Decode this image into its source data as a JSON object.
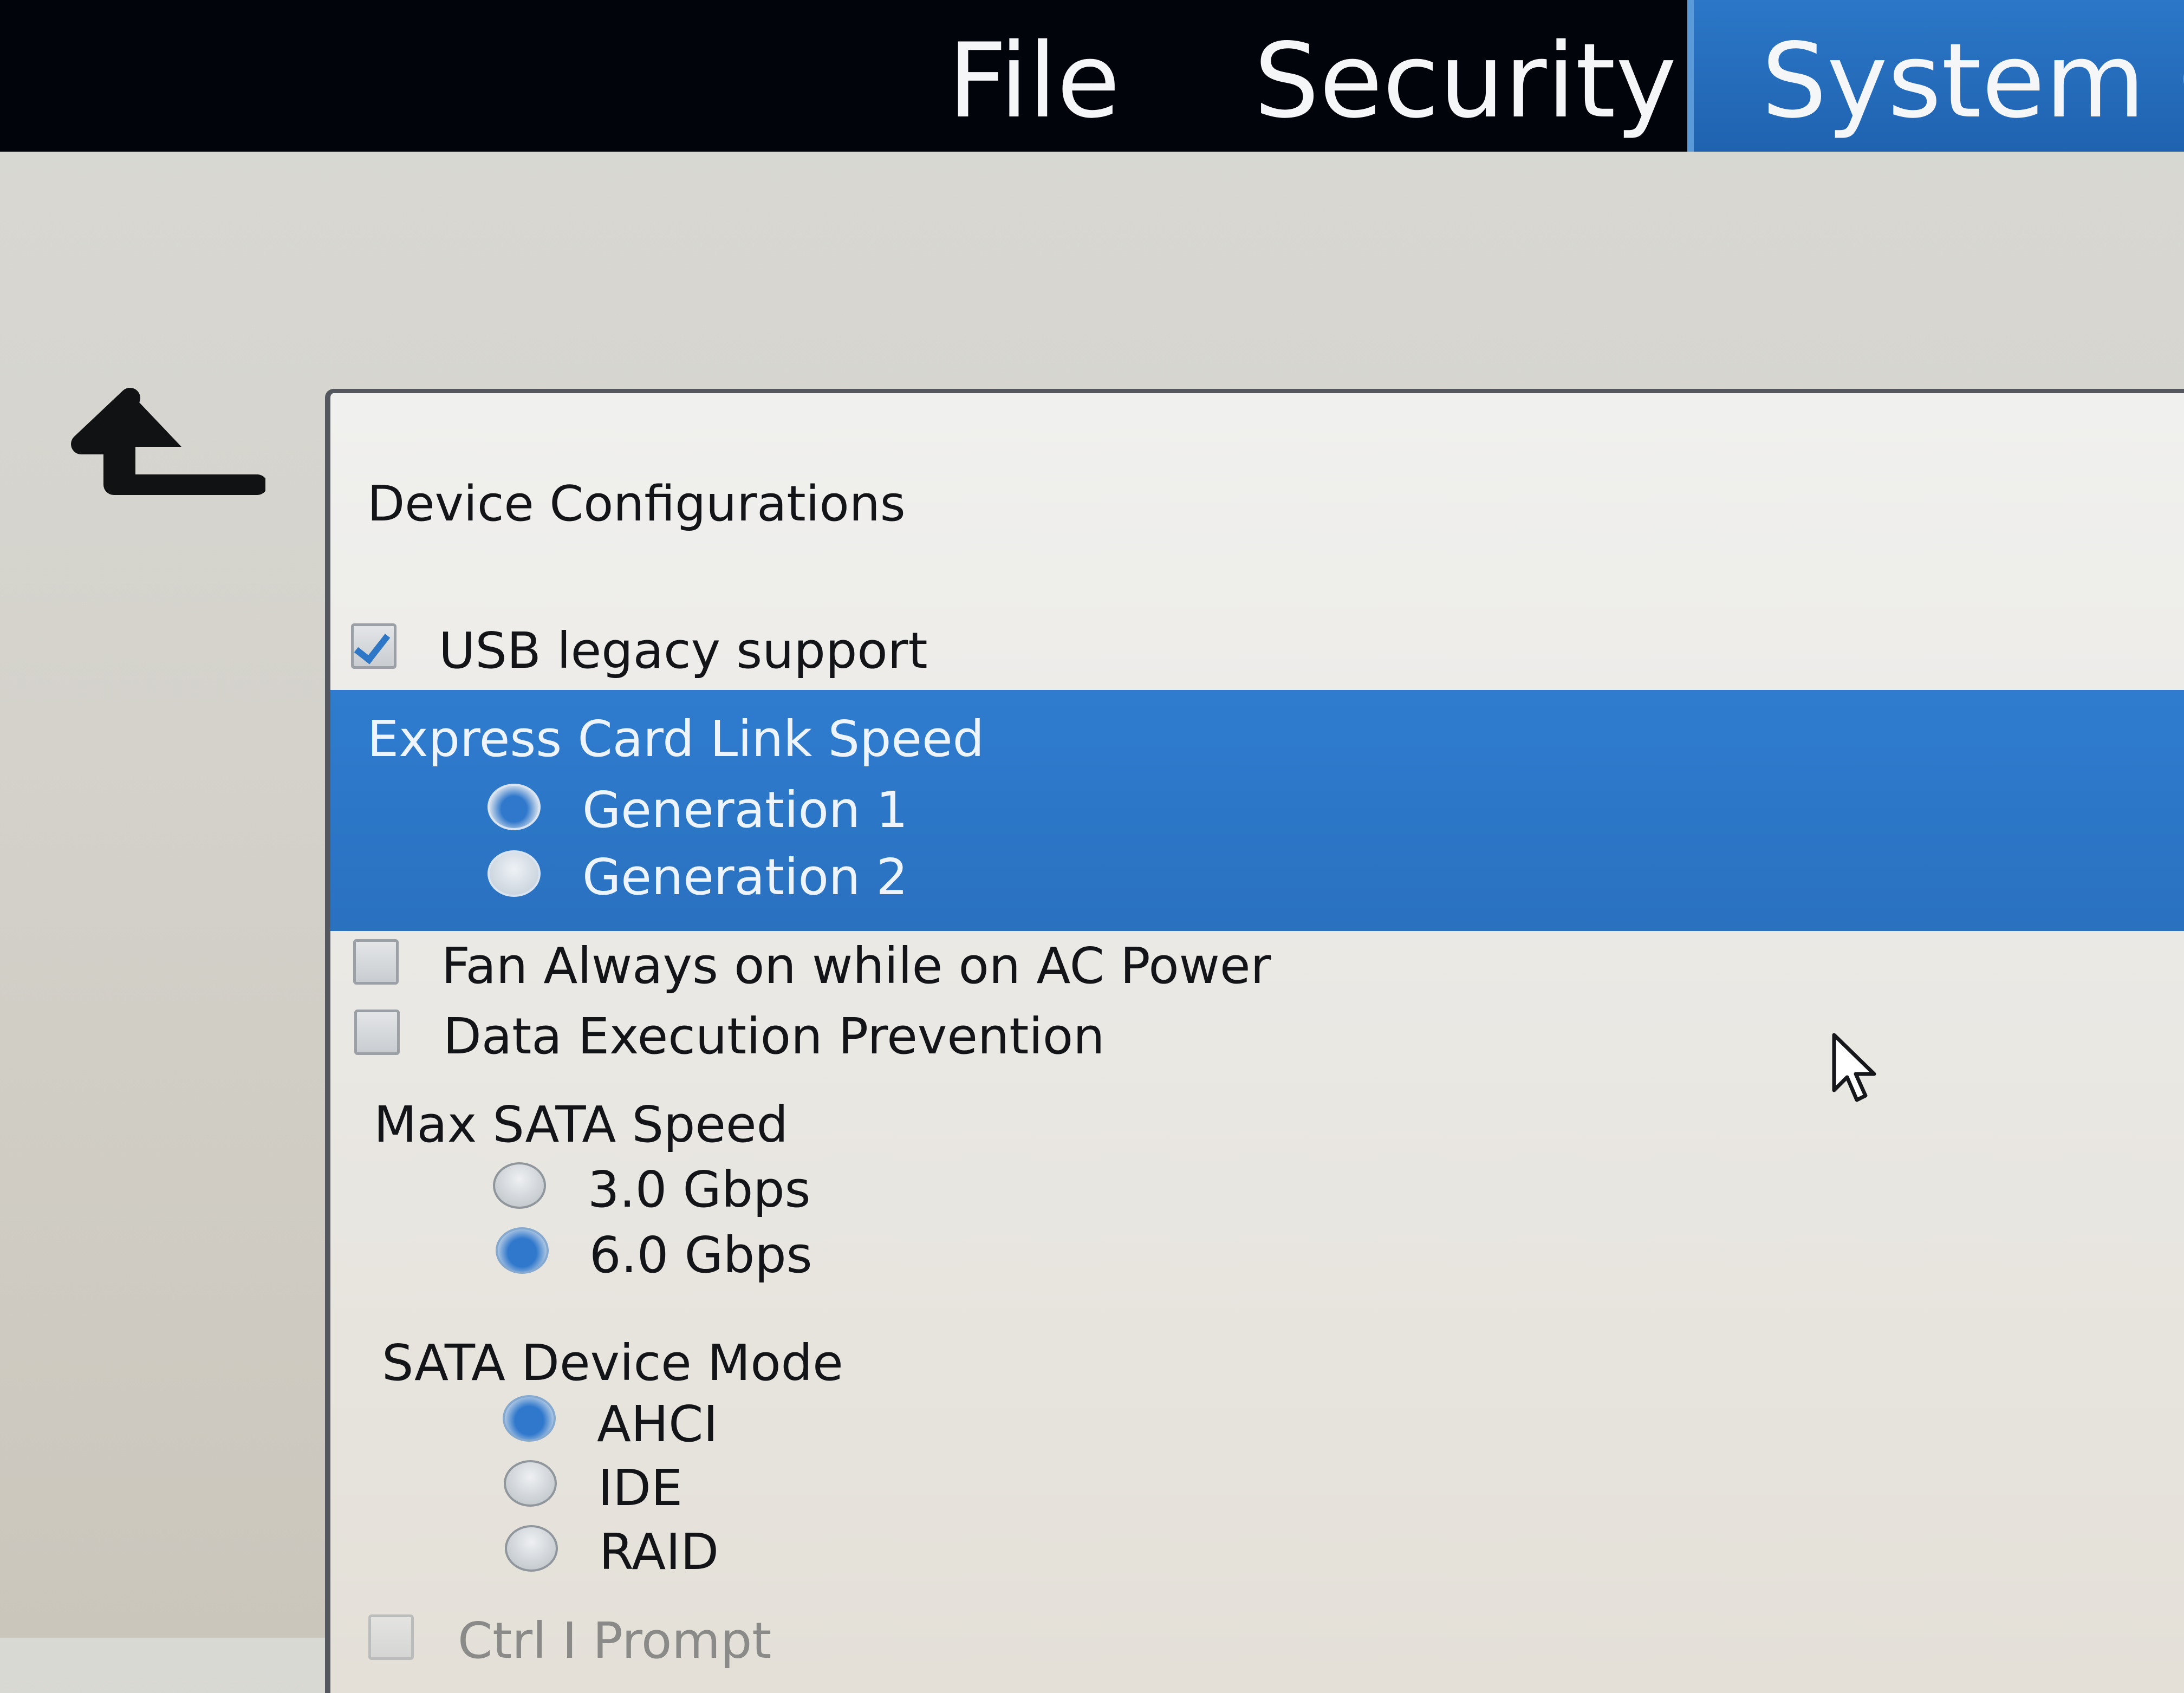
{
  "menu": {
    "items": [
      {
        "label": "File"
      },
      {
        "label": "Security"
      },
      {
        "label": "System Co",
        "active": true
      }
    ]
  },
  "icons": {
    "back": "back-arrow-icon",
    "cursor": "mouse-pointer-icon"
  },
  "colors": {
    "accent": "#2f7ccf",
    "menubar": "#02040b",
    "panel": "#eceae5"
  },
  "panel": {
    "title": "Device Configurations",
    "usb_legacy": {
      "label": "USB legacy support",
      "checked": true
    },
    "express_card": {
      "label": "Express Card Link Speed",
      "options": [
        "Generation 1",
        "Generation 2"
      ],
      "selected": 0
    },
    "fan_always_on": {
      "label": "Fan Always on while on AC Power",
      "checked": false
    },
    "data_execution_prevention": {
      "label": "Data Execution Prevention",
      "checked": false
    },
    "max_sata_speed": {
      "label": "Max SATA Speed",
      "options": [
        "3.0 Gbps",
        "6.0 Gbps"
      ],
      "selected": 1
    },
    "sata_device_mode": {
      "label": "SATA Device Mode",
      "options": [
        "AHCI",
        "IDE",
        "RAID"
      ],
      "selected": 0
    },
    "ctrl_prompt": {
      "label": "Ctrl I Prompt",
      "checked": false
    }
  }
}
